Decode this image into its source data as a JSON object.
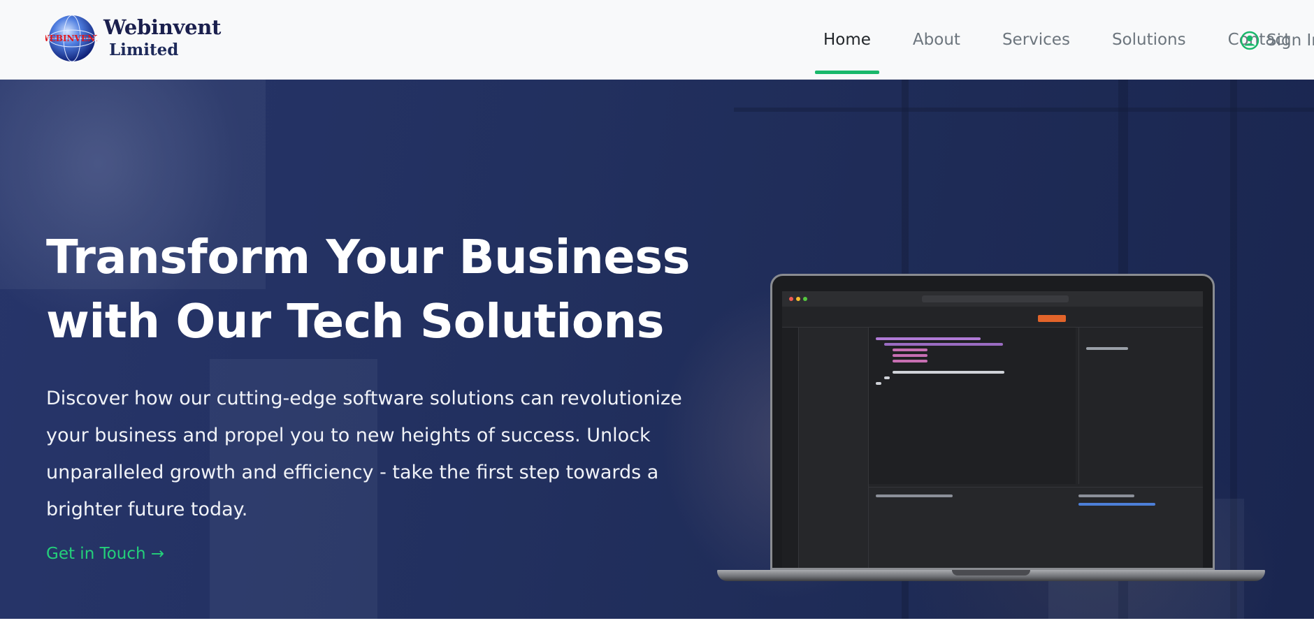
{
  "brand": {
    "logo_text": "WEBINVENT",
    "name": "Webinvent",
    "subtitle": "Limited"
  },
  "nav": {
    "items": [
      {
        "label": "Home",
        "active": true
      },
      {
        "label": "About",
        "active": false
      },
      {
        "label": "Services",
        "active": false
      },
      {
        "label": "Solutions",
        "active": false
      },
      {
        "label": "Contact",
        "active": false
      }
    ],
    "signin": {
      "label": "Sign In",
      "icon": "user-circle-icon"
    }
  },
  "hero": {
    "title_line1": "Transform Your Business",
    "title_line2": "with Our Tech Solutions",
    "description": "Discover how our cutting-edge software solutions can revolutionize your business and propel you to new heights of success. Unlock unparalleled growth and efficiency - take the first step towards a brighter future today.",
    "cta": "Get in Touch →",
    "image": "laptop-with-code-editor"
  },
  "colors": {
    "accent": "#19b86b",
    "cta_text": "#24d07a",
    "hero_overlay": "#22305f",
    "nav_text": "#6c757d",
    "nav_active": "#212529"
  }
}
